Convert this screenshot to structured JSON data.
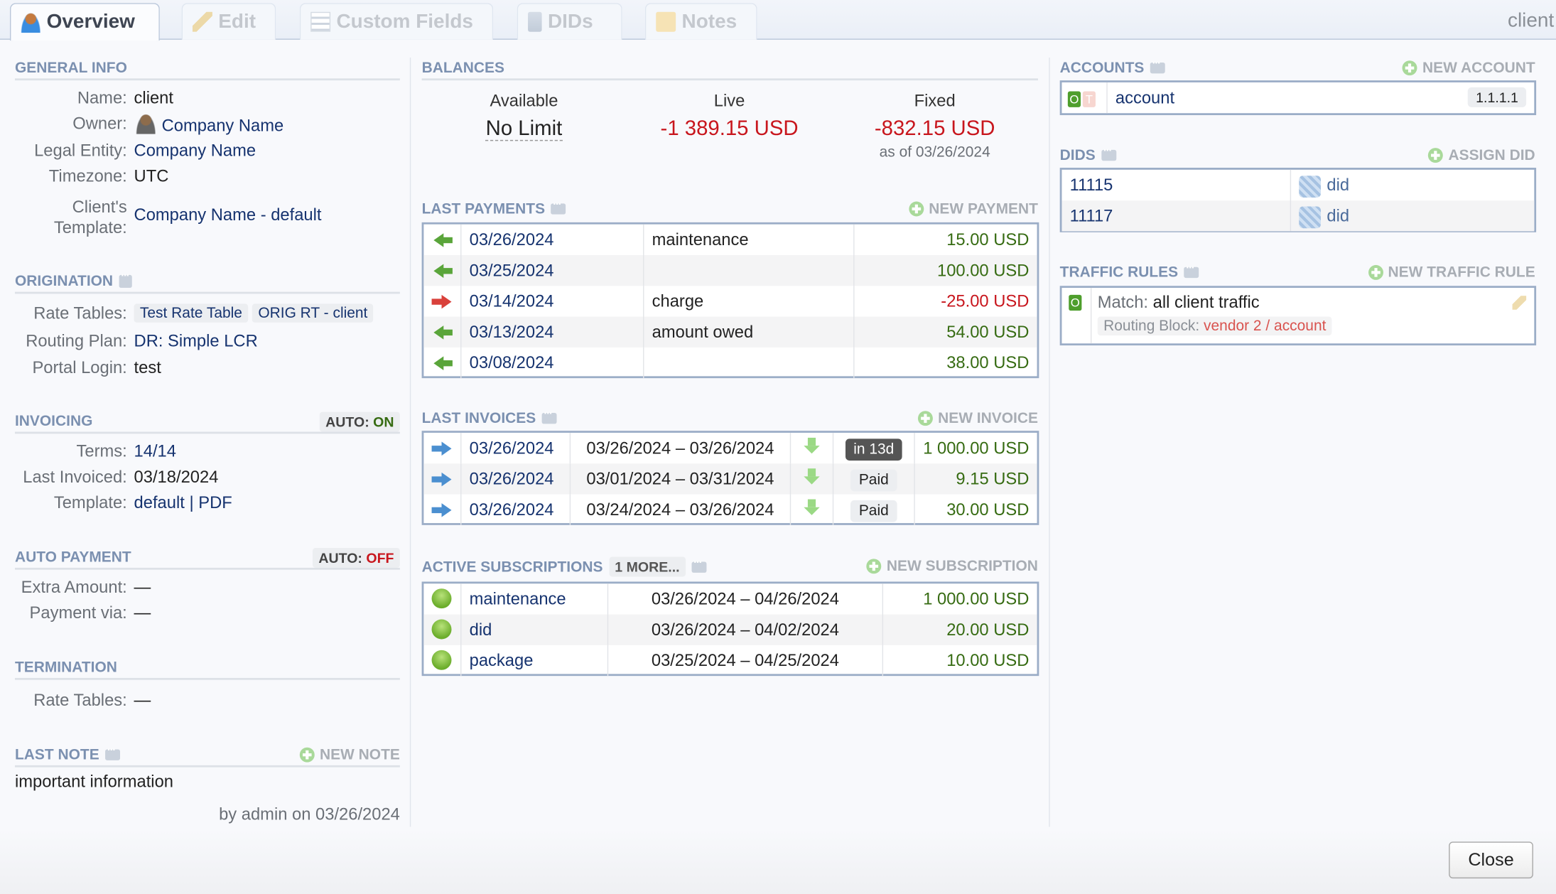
{
  "window": {
    "title": "client"
  },
  "tabs": [
    {
      "label": "Overview",
      "icon": "person-icon",
      "active": true
    },
    {
      "label": "Edit",
      "icon": "pencil-icon"
    },
    {
      "label": "Custom Fields",
      "icon": "list-icon"
    },
    {
      "label": "DIDs",
      "icon": "phone-hash-icon"
    },
    {
      "label": "Notes",
      "icon": "note-icon"
    }
  ],
  "general_info": {
    "title": "GENERAL INFO",
    "name_label": "Name:",
    "name": "client",
    "owner_label": "Owner:",
    "owner": "Company Name",
    "legal_label": "Legal Entity:",
    "legal": "Company Name",
    "tz_label": "Timezone:",
    "tz": "UTC",
    "template_label_1": "Client's",
    "template_label_2": "Template:",
    "template": "Company Name - default"
  },
  "origination": {
    "title": "ORIGINATION",
    "rate_tables_label": "Rate Tables:",
    "rate_tables": [
      "Test Rate Table",
      "ORIG RT - client"
    ],
    "routing_label": "Routing Plan:",
    "routing": "DR: Simple LCR",
    "portal_label": "Portal Login:",
    "portal": "test"
  },
  "invoicing": {
    "title": "INVOICING",
    "auto_label": "AUTO:",
    "auto_value": "ON",
    "terms_label": "Terms:",
    "terms": "14/14",
    "last_label": "Last Invoiced:",
    "last": "03/18/2024",
    "template_label": "Template:",
    "template": "default",
    "sep": "|",
    "pdf": "PDF"
  },
  "auto_payment": {
    "title": "AUTO PAYMENT",
    "auto_label": "AUTO:",
    "auto_value": "OFF",
    "extra_label": "Extra Amount:",
    "extra": "—",
    "via_label": "Payment via:",
    "via": "—"
  },
  "termination": {
    "title": "TERMINATION",
    "rate_tables_label": "Rate Tables:",
    "rate_tables": "—"
  },
  "last_note": {
    "title": "LAST NOTE",
    "new_label": "NEW NOTE",
    "text": "important information",
    "byline": "by admin on 03/26/2024"
  },
  "balances": {
    "title": "BALANCES",
    "available_label": "Available",
    "available": "No Limit",
    "live_label": "Live",
    "live": "-1 389.15 USD",
    "fixed_label": "Fixed",
    "fixed": "-832.15 USD",
    "as_of": "as of 03/26/2024"
  },
  "last_payments": {
    "title": "LAST PAYMENTS",
    "new_label": "NEW PAYMENT",
    "rows": [
      {
        "dir": "in",
        "date": "03/26/2024",
        "desc": "maintenance",
        "amount": "15.00 USD"
      },
      {
        "dir": "in",
        "date": "03/25/2024",
        "desc": "",
        "amount": "100.00 USD"
      },
      {
        "dir": "out",
        "date": "03/14/2024",
        "desc": "charge",
        "amount": "-25.00 USD"
      },
      {
        "dir": "in",
        "date": "03/13/2024",
        "desc": "amount owed",
        "amount": "54.00 USD"
      },
      {
        "dir": "in",
        "date": "03/08/2024",
        "desc": "",
        "amount": "38.00 USD"
      }
    ]
  },
  "last_invoices": {
    "title": "LAST INVOICES",
    "new_label": "NEW INVOICE",
    "rows": [
      {
        "date": "03/26/2024",
        "period": "03/26/2024 – 03/26/2024",
        "status": "in 13d",
        "amount": "1 000.00 USD"
      },
      {
        "date": "03/26/2024",
        "period": "03/01/2024 – 03/31/2024",
        "status": "Paid",
        "amount": "9.15 USD"
      },
      {
        "date": "03/26/2024",
        "period": "03/24/2024 – 03/26/2024",
        "status": "Paid",
        "amount": "30.00 USD"
      }
    ]
  },
  "subscriptions": {
    "title": "ACTIVE SUBSCRIPTIONS",
    "more_label": "1 MORE...",
    "new_label": "NEW SUBSCRIPTION",
    "rows": [
      {
        "name": "maintenance",
        "period": "03/26/2024 – 04/26/2024",
        "amount": "1 000.00 USD"
      },
      {
        "name": "did",
        "period": "03/26/2024 – 04/02/2024",
        "amount": "20.00 USD"
      },
      {
        "name": "package",
        "period": "03/25/2024 – 04/25/2024",
        "amount": "10.00 USD"
      }
    ]
  },
  "accounts": {
    "title": "ACCOUNTS",
    "new_label": "NEW ACCOUNT",
    "rows": [
      {
        "flag_o": "O",
        "flag_t": "T",
        "name": "account",
        "ip": "1.1.1.1"
      }
    ]
  },
  "dids": {
    "title": "DIDS",
    "new_label": "ASSIGN DID",
    "rows": [
      {
        "number": "11115",
        "name": "did"
      },
      {
        "number": "11117",
        "name": "did"
      }
    ]
  },
  "traffic_rules": {
    "title": "TRAFFIC RULES",
    "new_label": "NEW TRAFFIC RULE",
    "flag": "O",
    "match_label": "Match:",
    "match": "all client traffic",
    "block_label": "Routing Block:",
    "block": "vendor 2 / account"
  },
  "footer": {
    "close_label": "Close"
  },
  "colors": {
    "accent": "#7b90b0",
    "link": "#16336f",
    "positive": "#366b12",
    "negative": "#c8161d",
    "border": "#9badc7"
  }
}
